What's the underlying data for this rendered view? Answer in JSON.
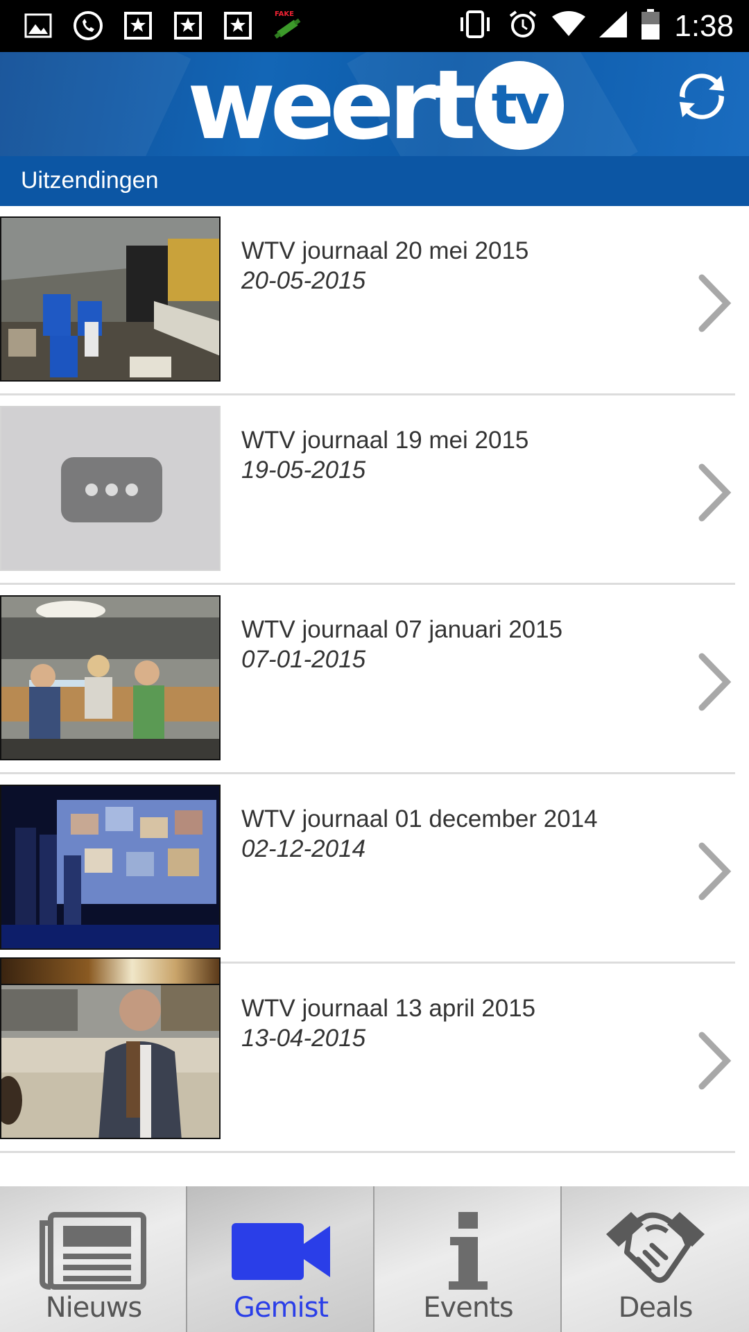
{
  "status_bar": {
    "time": "1:38",
    "left_icons": [
      "gallery-icon",
      "whatsapp-icon",
      "bookmark-star-icon",
      "bookmark-star-icon",
      "bookmark-star-icon",
      "fake-gps-icon"
    ],
    "right_icons": [
      "vibrate-icon",
      "alarm-icon",
      "wifi-icon",
      "signal-icon",
      "battery-icon"
    ]
  },
  "header": {
    "logo_text": "weert",
    "logo_badge": "tv",
    "refresh_icon": "refresh-icon",
    "color": "#1366b6"
  },
  "section": {
    "title": "Uitzendingen",
    "color": "#0c56a4"
  },
  "broadcasts": [
    {
      "title": "WTV journaal 20 mei 2015",
      "date": "20-05-2015",
      "thumbnail": "warehouse-barrels"
    },
    {
      "title": "WTV journaal 19 mei 2015",
      "date": "19-05-2015",
      "thumbnail": "placeholder-video"
    },
    {
      "title": "WTV journaal 07 januari 2015",
      "date": "07-01-2015",
      "thumbnail": "children-at-tables"
    },
    {
      "title": "WTV journaal 01 december 2014",
      "date": "02-12-2014",
      "thumbnail": "stage-screen"
    },
    {
      "title": "WTV journaal 13 april 2015",
      "date": "13-04-2015",
      "thumbnail": "man-with-scarf"
    }
  ],
  "bottom_nav": [
    {
      "label": "Nieuws",
      "icon": "newspaper-icon",
      "active": false
    },
    {
      "label": "Gemist",
      "icon": "video-camera-icon",
      "active": true
    },
    {
      "label": "Events",
      "icon": "info-icon",
      "active": false
    },
    {
      "label": "Deals",
      "icon": "handshake-icon",
      "active": false
    }
  ],
  "colors": {
    "active_tab": "#2a3ee8",
    "inactive_tab": "#555555"
  }
}
